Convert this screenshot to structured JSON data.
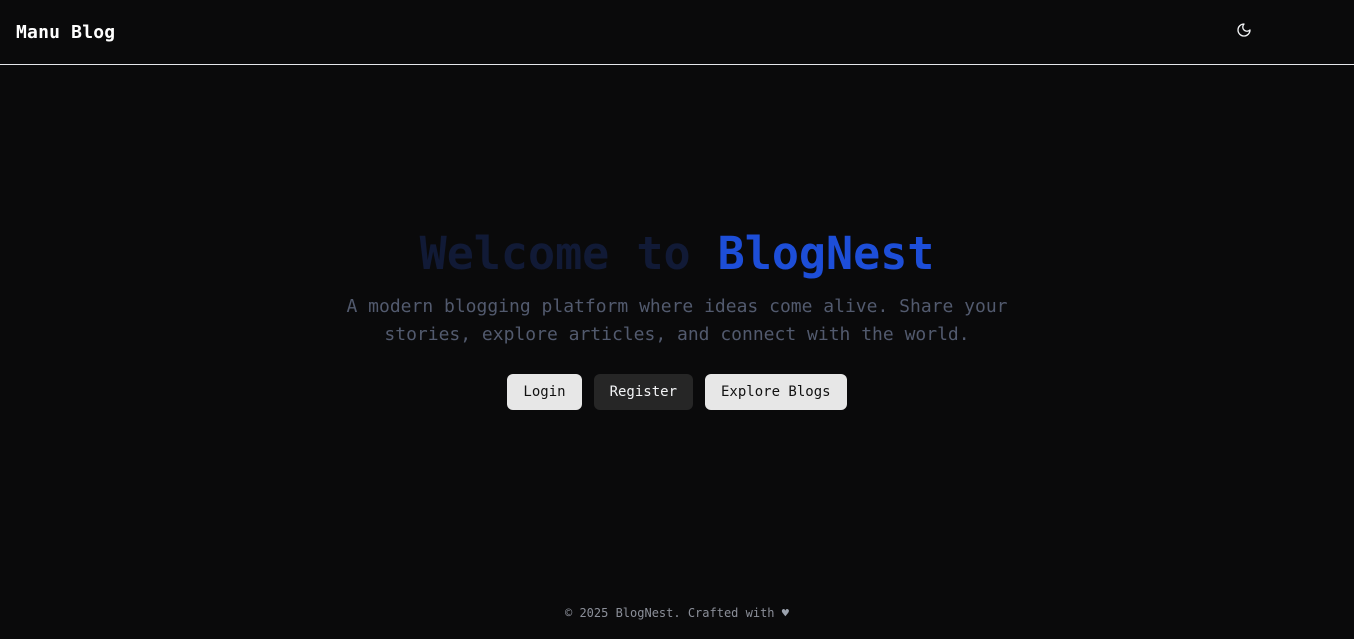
{
  "navbar": {
    "brand": "Manu Blog",
    "theme_toggle_icon": "moon-icon"
  },
  "hero": {
    "title_prefix": "Welcome to",
    "title_brand": "BlogNest",
    "subtitle": "A modern blogging platform where ideas come alive. Share your stories, explore articles, and connect with the world."
  },
  "actions": {
    "login_label": "Login",
    "register_label": "Register",
    "explore_label": "Explore Blogs"
  },
  "footer": {
    "text": "© 2025 BlogNest. Crafted with",
    "heart": "♥"
  },
  "colors": {
    "background": "#0a0a0b",
    "accent": "#1d4ed8",
    "title_dim": "#111a36"
  }
}
